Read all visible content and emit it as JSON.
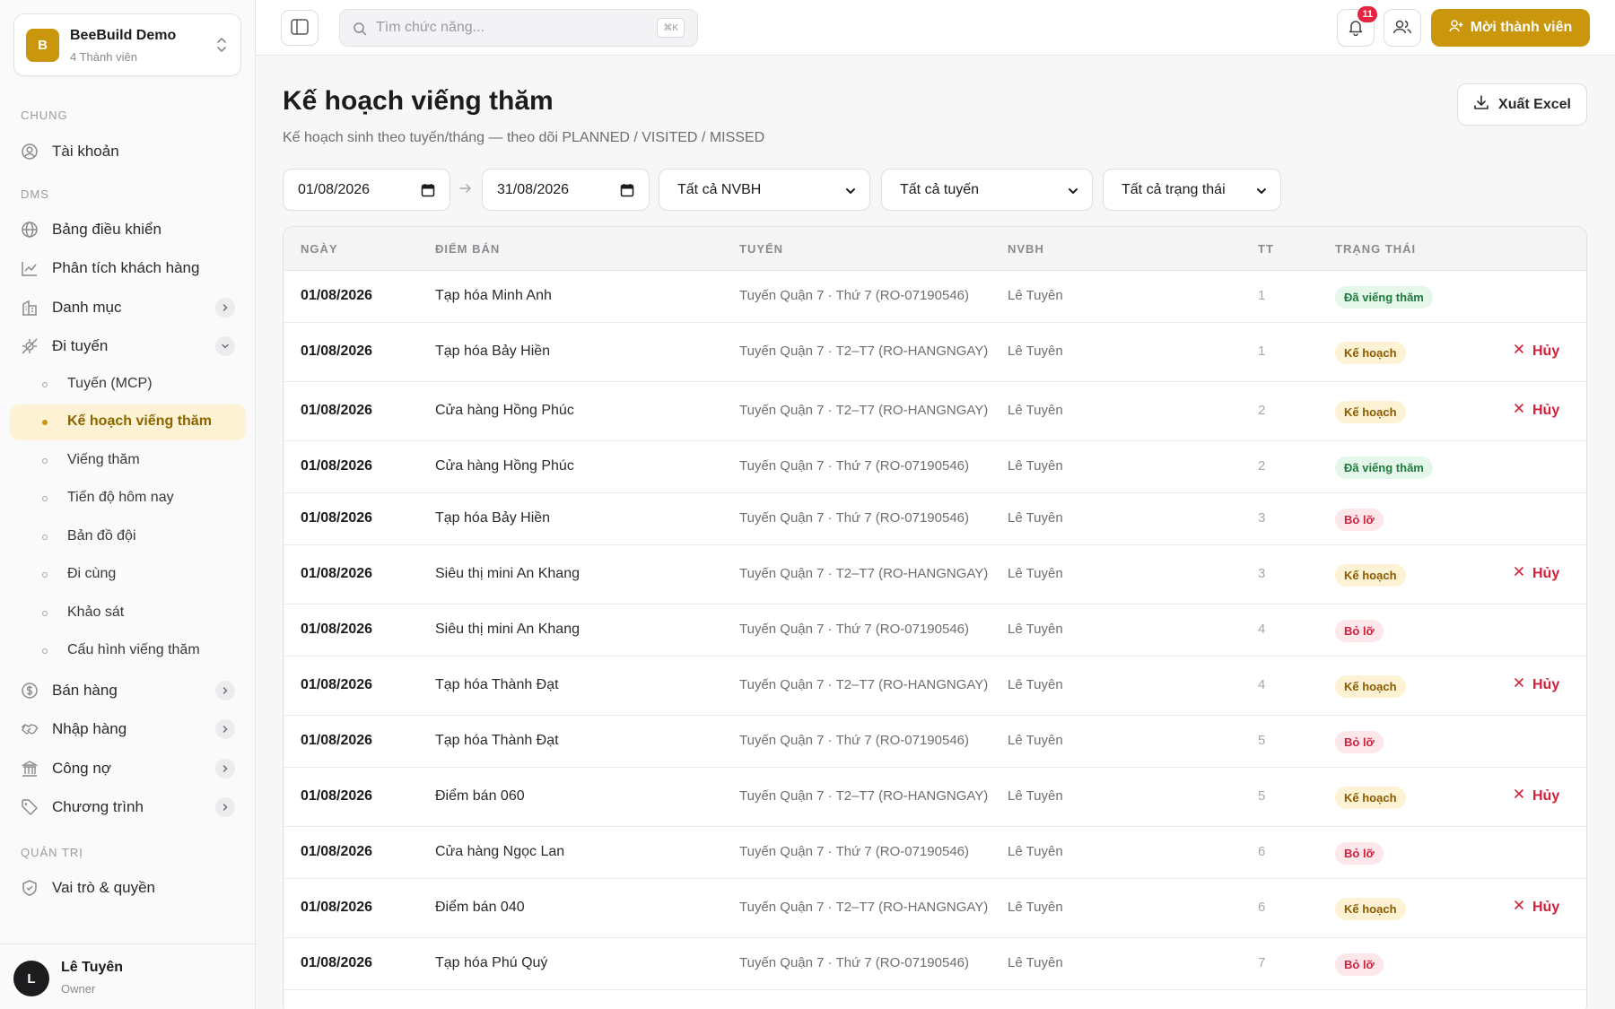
{
  "org": {
    "logo_letter": "B",
    "name": "BeeBuild Demo",
    "members": "4 Thành viên"
  },
  "sidebar": {
    "sections": {
      "general": "CHUNG",
      "dms": "DMS",
      "admin": "QUẢN TRỊ"
    },
    "account": "Tài khoản",
    "dashboard": "Bảng điều khiển",
    "customer_analytics": "Phân tích khách hàng",
    "catalog": "Danh mục",
    "routing": "Đi tuyến",
    "routing_items": [
      "Tuyến (MCP)",
      "Kế hoạch viếng thăm",
      "Viếng thăm",
      "Tiến độ hôm nay",
      "Bản đồ đội",
      "Đi cùng",
      "Khảo sát",
      "Cấu hình viếng thăm"
    ],
    "sales": "Bán hàng",
    "purchasing": "Nhập hàng",
    "debt": "Công nợ",
    "programs": "Chương trình",
    "roles": "Vai trò & quyền"
  },
  "user": {
    "initial": "L",
    "name": "Lê Tuyên",
    "role": "Owner"
  },
  "topbar": {
    "search_placeholder": "Tìm chức năng...",
    "search_shortcut": "⌘K",
    "notification_count": "11",
    "invite_label": "Mời thành viên"
  },
  "page": {
    "title": "Kế hoạch viếng thăm",
    "subtitle": "Kế hoạch sinh theo tuyến/tháng — theo dõi PLANNED / VISITED / MISSED",
    "export_label": "Xuất Excel"
  },
  "filters": {
    "date_from": "01/08/2026",
    "date_to": "31/08/2026",
    "salesperson": "Tất cả NVBH",
    "route": "Tất cả tuyến",
    "status": "Tất cả trạng thái"
  },
  "table": {
    "headers": {
      "date": "NGÀY",
      "shop": "ĐIỂM BÁN",
      "route": "TUYẾN",
      "nvbh": "NVBH",
      "tt": "TT",
      "status": "TRẠNG THÁI"
    },
    "cancel_label": "Hủy",
    "status_labels": {
      "visited": "Đã viếng thăm",
      "planned": "Kế hoạch",
      "missed": "Bỏ lỡ"
    },
    "rows": [
      {
        "date": "01/08/2026",
        "shop": "Tạp hóa Minh Anh",
        "route": "Tuyến Quận 7 · Thứ 7 (RO-07190546)",
        "nvbh": "Lê Tuyên",
        "tt": "1",
        "status": "Đã viếng thăm",
        "kind": "visited"
      },
      {
        "date": "01/08/2026",
        "shop": "Tạp hóa Bảy Hiền",
        "route": "Tuyến Quận 7 · T2–T7 (RO-HANGNGAY)",
        "nvbh": "Lê Tuyên",
        "tt": "1",
        "status": "Kế hoạch",
        "kind": "planned"
      },
      {
        "date": "01/08/2026",
        "shop": "Cửa hàng Hồng Phúc",
        "route": "Tuyến Quận 7 · T2–T7 (RO-HANGNGAY)",
        "nvbh": "Lê Tuyên",
        "tt": "2",
        "status": "Kế hoạch",
        "kind": "planned"
      },
      {
        "date": "01/08/2026",
        "shop": "Cửa hàng Hồng Phúc",
        "route": "Tuyến Quận 7 · Thứ 7 (RO-07190546)",
        "nvbh": "Lê Tuyên",
        "tt": "2",
        "status": "Đã viếng thăm",
        "kind": "visited"
      },
      {
        "date": "01/08/2026",
        "shop": "Tạp hóa Bảy Hiền",
        "route": "Tuyến Quận 7 · Thứ 7 (RO-07190546)",
        "nvbh": "Lê Tuyên",
        "tt": "3",
        "status": "Bỏ lỡ",
        "kind": "missed"
      },
      {
        "date": "01/08/2026",
        "shop": "Siêu thị mini An Khang",
        "route": "Tuyến Quận 7 · T2–T7 (RO-HANGNGAY)",
        "nvbh": "Lê Tuyên",
        "tt": "3",
        "status": "Kế hoạch",
        "kind": "planned"
      },
      {
        "date": "01/08/2026",
        "shop": "Siêu thị mini An Khang",
        "route": "Tuyến Quận 7 · Thứ 7 (RO-07190546)",
        "nvbh": "Lê Tuyên",
        "tt": "4",
        "status": "Bỏ lỡ",
        "kind": "missed"
      },
      {
        "date": "01/08/2026",
        "shop": "Tạp hóa Thành Đạt",
        "route": "Tuyến Quận 7 · T2–T7 (RO-HANGNGAY)",
        "nvbh": "Lê Tuyên",
        "tt": "4",
        "status": "Kế hoạch",
        "kind": "planned"
      },
      {
        "date": "01/08/2026",
        "shop": "Tạp hóa Thành Đạt",
        "route": "Tuyến Quận 7 · Thứ 7 (RO-07190546)",
        "nvbh": "Lê Tuyên",
        "tt": "5",
        "status": "Bỏ lỡ",
        "kind": "missed"
      },
      {
        "date": "01/08/2026",
        "shop": "Điểm bán 060",
        "route": "Tuyến Quận 7 · T2–T7 (RO-HANGNGAY)",
        "nvbh": "Lê Tuyên",
        "tt": "5",
        "status": "Kế hoạch",
        "kind": "planned"
      },
      {
        "date": "01/08/2026",
        "shop": "Cửa hàng Ngọc Lan",
        "route": "Tuyến Quận 7 · Thứ 7 (RO-07190546)",
        "nvbh": "Lê Tuyên",
        "tt": "6",
        "status": "Bỏ lỡ",
        "kind": "missed"
      },
      {
        "date": "01/08/2026",
        "shop": "Điểm bán 040",
        "route": "Tuyến Quận 7 · T2–T7 (RO-HANGNGAY)",
        "nvbh": "Lê Tuyên",
        "tt": "6",
        "status": "Kế hoạch",
        "kind": "planned"
      },
      {
        "date": "01/08/2026",
        "shop": "Tạp hóa Phú Quý",
        "route": "Tuyến Quận 7 · Thứ 7 (RO-07190546)",
        "nvbh": "Lê Tuyên",
        "tt": "7",
        "status": "Bỏ lỡ",
        "kind": "missed"
      }
    ]
  },
  "colors": {
    "accent": "#c9960c",
    "danger": "#d0213b",
    "success": "#1e7b3c"
  }
}
